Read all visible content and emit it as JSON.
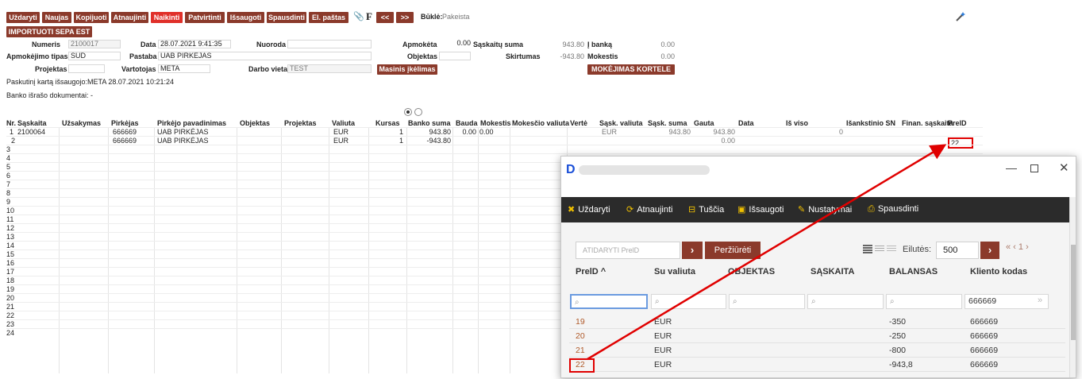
{
  "toolbar": {
    "buttons": [
      "Uždaryti",
      "Naujas",
      "Kopijuoti",
      "Atnaujinti",
      "Naikinti",
      "Patvirtinti",
      "Išsaugoti",
      "Spausdinti",
      "El. paštas"
    ],
    "paperclip_icon": "📎",
    "f_label": "F",
    "prev": "<<",
    "next": ">>",
    "status_label": "Būklė:",
    "status_value": "Pakeista",
    "import_button": "IMPORTUOTI SEPA EST"
  },
  "header": {
    "numeris_label": "Numeris",
    "numeris": "2100017",
    "data_label": "Data",
    "data": "28.07.2021 9:41:35",
    "nuoroda_label": "Nuoroda",
    "nuoroda": "",
    "apmoketa_label": "Apmokėta",
    "apmoketa": "0.00",
    "saskaitu_suma_label": "Sąskaitų suma",
    "saskaitu_suma": "943.80",
    "i_banka_label": "Į banką",
    "i_banka": "0.00",
    "apmokejimo_tipas_label": "Apmokėjimo tipas",
    "apmokejimo_tipas": "SUD",
    "pastaba_label": "Pastaba",
    "pastaba": "UAB PIRKĖJAS",
    "objektas_label": "Objektas",
    "objektas": "",
    "skirtumas_label": "Skirtumas",
    "skirtumas": "-943.80",
    "mokestis_label": "Mokestis",
    "mokestis": "0.00",
    "projektas_label": "Projektas",
    "projektas": "",
    "vartotojas_label": "Vartotojas",
    "vartotojas": "META",
    "darbo_vieta_label": "Darbo vieta",
    "darbo_vieta": "TEST",
    "masinis_button": "Masinis įkėlimas",
    "mokejimas_button": "MOKĖJIMAS KORTELE",
    "last_saved": "Paskutinį kartą išsaugojo:META 28.07.2021 10:21:24",
    "bank_docs": "Banko išrašo dokumentai: -"
  },
  "grid": {
    "columns": [
      "Nr.",
      "Sąskaita",
      "Užsakymas",
      "Pirkėjas",
      "Pirkėjo pavadinimas",
      "Objektas",
      "Projektas",
      "Valiuta",
      "Kursas",
      "Banko suma",
      "Bauda",
      "Mokestis",
      "Mokesčio valiuta",
      "Vertė",
      "Sąsk. valiuta",
      "Sąsk. suma",
      "Gauta",
      "Data",
      "Iš viso",
      "Išankstinio SN",
      "Finan. sąskaita",
      "PrelD"
    ],
    "rows": [
      {
        "nr": "1",
        "saskaita": "2100064",
        "pirkejas": "666669",
        "pavadinimas": "UAB PIRKĖJAS",
        "valiuta": "EUR",
        "kursas": "1",
        "banko_suma": "943.80",
        "bauda": "0.00",
        "mokestis": "0.00",
        "sask_valiuta": "EUR",
        "sask_suma": "943.80",
        "gauta": "943.80",
        "isankstinio": "0",
        "preid": ""
      },
      {
        "nr": "2",
        "saskaita": "",
        "pirkejas": "666669",
        "pavadinimas": "UAB PIRKĖJAS",
        "valiuta": "EUR",
        "kursas": "1",
        "banko_suma": "-943.80",
        "bauda": "",
        "mokestis": "",
        "sask_valiuta": "",
        "sask_suma": "",
        "gauta": "0.00",
        "isankstinio": "",
        "preid": "22"
      }
    ],
    "row_numbers": [
      "3",
      "4",
      "5",
      "6",
      "7",
      "8",
      "9",
      "10",
      "11",
      "12",
      "13",
      "14",
      "15",
      "16",
      "17",
      "18",
      "19",
      "20",
      "21",
      "22",
      "23",
      "24"
    ]
  },
  "popup": {
    "toolbar": [
      "Uždaryti",
      "Atnaujinti",
      "Tuščia",
      "Išsaugoti",
      "Nustatymai",
      "Spausdinti"
    ],
    "search_placeholder": "ATIDARYTI PrelD",
    "view_button": "Peržiūrėti",
    "rows_label": "Eilutės:",
    "rows_value": "500",
    "pager": "« ‹ 1 ›",
    "columns": [
      "PrelD ^",
      "Su valiuta",
      "OBJEKTAS",
      "SĄSKAITA",
      "BALANSAS",
      "Kliento kodas"
    ],
    "filter_kliento": "666669",
    "rows": [
      {
        "preid": "19",
        "valiuta": "EUR",
        "balansas": "-350",
        "kliento": "666669"
      },
      {
        "preid": "20",
        "valiuta": "EUR",
        "balansas": "-250",
        "kliento": "666669"
      },
      {
        "preid": "21",
        "valiuta": "EUR",
        "balansas": "-800",
        "kliento": "666669"
      },
      {
        "preid": "22",
        "valiuta": "EUR",
        "balansas": "-943,8",
        "kliento": "666669"
      }
    ]
  }
}
